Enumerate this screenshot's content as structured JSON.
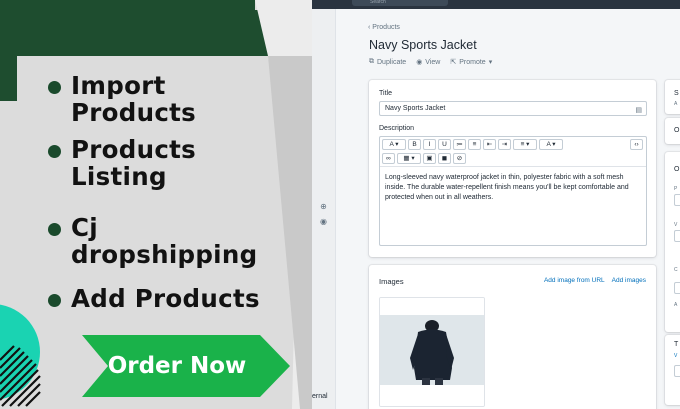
{
  "promo": {
    "bullets": [
      "Import Products",
      "Products Listing",
      "Cj dropshipping",
      "Add Products"
    ],
    "order_label": "Order Now",
    "colors": {
      "dark_green": "#1e4d2f",
      "bright_green": "#1ab24a",
      "teal": "#1ad3b2",
      "gray": "#dcdcdc"
    }
  },
  "admin": {
    "search_placeholder": "Search",
    "breadcrumb": "Products",
    "title": "Navy Sports Jacket",
    "actions": {
      "duplicate": "Duplicate",
      "view": "View",
      "promote": "Promote"
    },
    "general_card": {
      "title_label": "Title",
      "title_value": "Navy Sports Jacket",
      "description_label": "Description",
      "description_text": "Long-sleeved navy waterproof jacket in thin, polyester fabric with a soft mesh inside. The durable water-repellent finish means you'll be kept comfortable and protected when out in all weathers."
    },
    "images_card": {
      "heading": "Images",
      "add_from_url": "Add image from URL",
      "add_images": "Add images"
    },
    "left_strip_text": "ernal",
    "side_cards": {
      "first_letter": "S",
      "first_sub": "A",
      "second_letter": "O",
      "third_letter": "O",
      "p_letter": "P",
      "v_letter": "V",
      "c_letter": "C",
      "a_letter": "A",
      "t_letter": "T",
      "v2_letter": "V"
    }
  }
}
